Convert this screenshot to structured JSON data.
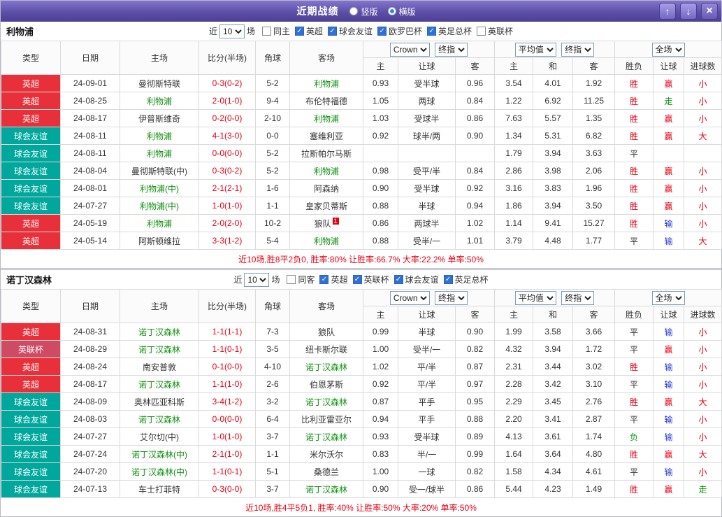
{
  "titlebar": {
    "title": "近期战绩",
    "view_options": [
      {
        "label": "竖版",
        "selected": false
      },
      {
        "label": "横版",
        "selected": true
      }
    ],
    "buttons": {
      "up": "↑",
      "down": "↓",
      "close": "×"
    }
  },
  "colors": {
    "league": {
      "英超": "#e8303a",
      "球会友谊": "#00a79d",
      "英联杯": "#cf4a63",
      "欧罗巴杯": "#cf7a2a",
      "英足总杯": "#3a6fd0"
    },
    "result": {
      "胜": "#e60012",
      "平": "#333333",
      "负": "#0a9a0a"
    },
    "handicap": {
      "赢": "#e60012",
      "走": "#0a9a0a",
      "输": "#2433cc"
    },
    "goals": {
      "大": "#e60012",
      "小": "#e60012",
      "走": "#0a9a0a"
    },
    "team_highlight": "#0a8f0a",
    "score": "#e60012",
    "checkbox_checked": "#2f71d8"
  },
  "table_header": {
    "type": "类型",
    "date": "日期",
    "home": "主场",
    "score": "比分(半场)",
    "corner": "角球",
    "away": "客场",
    "odds1": {
      "select1": "Crown",
      "select2": "终指",
      "cols": [
        "主",
        "让球",
        "客"
      ]
    },
    "odds2": {
      "select1": "平均值",
      "select2": "终指",
      "cols": [
        "主",
        "和",
        "客"
      ]
    },
    "result_group": {
      "select": "全场",
      "cols": [
        "胜负",
        "让球",
        "进球数"
      ]
    }
  },
  "sections": [
    {
      "team": "利物浦",
      "filter": {
        "prefix": "近",
        "count": "10",
        "suffix": "场",
        "checkboxes": [
          {
            "label": "同主",
            "checked": false
          },
          {
            "label": "英超",
            "checked": true
          },
          {
            "label": "球会友谊",
            "checked": true
          },
          {
            "label": "欧罗巴杯",
            "checked": true
          },
          {
            "label": "英足总杯",
            "checked": true
          },
          {
            "label": "英联杯",
            "checked": false
          }
        ]
      },
      "rows": [
        {
          "league": "英超",
          "date": "24-09-01",
          "home": "曼彻斯特联",
          "score": "0-3(0-2)",
          "corner": "5-2",
          "away": "利物浦",
          "o1": [
            "0.93",
            "受半球",
            "0.96"
          ],
          "o2": [
            "3.54",
            "4.01",
            "1.92"
          ],
          "res": "胜",
          "bet": "赢",
          "goal": "小"
        },
        {
          "league": "英超",
          "date": "24-08-25",
          "home": "利物浦",
          "score": "2-0(1-0)",
          "corner": "9-4",
          "away": "布伦特福德",
          "o1": [
            "1.05",
            "两球",
            "0.84"
          ],
          "o2": [
            "1.22",
            "6.92",
            "11.25"
          ],
          "res": "胜",
          "bet": "走",
          "goal": "小"
        },
        {
          "league": "英超",
          "date": "24-08-17",
          "home": "伊普斯维奇",
          "score": "0-2(0-0)",
          "corner": "2-10",
          "away": "利物浦",
          "o1": [
            "1.03",
            "受球半",
            "0.86"
          ],
          "o2": [
            "7.63",
            "5.57",
            "1.35"
          ],
          "res": "胜",
          "bet": "赢",
          "goal": "小"
        },
        {
          "league": "球会友谊",
          "date": "24-08-11",
          "home": "利物浦",
          "score": "4-1(3-0)",
          "corner": "0-0",
          "away": "塞维利亚",
          "o1": [
            "0.92",
            "球半/两",
            "0.90"
          ],
          "o2": [
            "1.34",
            "5.31",
            "6.82"
          ],
          "res": "胜",
          "bet": "赢",
          "goal": "大"
        },
        {
          "league": "球会友谊",
          "date": "24-08-11",
          "home": "利物浦",
          "score": "0-0(0-0)",
          "corner": "5-2",
          "away": "拉斯帕尔马斯",
          "o1": [
            "",
            "",
            ""
          ],
          "o2": [
            "1.79",
            "3.94",
            "3.63"
          ],
          "res": "平",
          "bet": "",
          "goal": ""
        },
        {
          "league": "球会友谊",
          "date": "24-08-04",
          "home": "曼彻斯特联(中)",
          "score": "0-3(0-2)",
          "corner": "5-2",
          "away": "利物浦",
          "o1": [
            "0.98",
            "受平/半",
            "0.84"
          ],
          "o2": [
            "2.86",
            "3.98",
            "2.06"
          ],
          "res": "胜",
          "bet": "赢",
          "goal": "小"
        },
        {
          "league": "球会友谊",
          "date": "24-08-01",
          "home": "利物浦(中)",
          "score": "2-1(2-1)",
          "corner": "1-6",
          "away": "阿森纳",
          "o1": [
            "0.90",
            "受半球",
            "0.92"
          ],
          "o2": [
            "3.16",
            "3.83",
            "1.96"
          ],
          "res": "胜",
          "bet": "赢",
          "goal": "小"
        },
        {
          "league": "球会友谊",
          "date": "24-07-27",
          "home": "利物浦(中)",
          "score": "1-0(1-0)",
          "corner": "1-1",
          "away": "皇家贝蒂斯",
          "o1": [
            "0.88",
            "半球",
            "0.94"
          ],
          "o2": [
            "1.86",
            "3.94",
            "3.50"
          ],
          "res": "胜",
          "bet": "赢",
          "goal": "小"
        },
        {
          "league": "英超",
          "date": "24-05-19",
          "home": "利物浦",
          "score": "2-0(2-0)",
          "corner": "10-2",
          "away": "狼队",
          "away_sup": "1",
          "o1": [
            "0.86",
            "两球半",
            "1.02"
          ],
          "o2": [
            "1.14",
            "9.41",
            "15.27"
          ],
          "res": "胜",
          "bet": "输",
          "goal": "小"
        },
        {
          "league": "英超",
          "date": "24-05-14",
          "home": "阿斯顿维拉",
          "score": "3-3(1-2)",
          "corner": "5-4",
          "away": "利物浦",
          "o1": [
            "0.88",
            "受半/一",
            "1.01"
          ],
          "o2": [
            "3.79",
            "4.48",
            "1.77"
          ],
          "res": "平",
          "bet": "输",
          "goal": "大"
        }
      ],
      "summary": "近10场,胜8平2负0, 胜率:80% 让胜率:66.7% 大率:22.2% 单率:50%"
    },
    {
      "team": "诺丁汉森林",
      "filter": {
        "prefix": "近",
        "count": "10",
        "suffix": "场",
        "checkboxes": [
          {
            "label": "同客",
            "checked": false
          },
          {
            "label": "英超",
            "checked": true
          },
          {
            "label": "英联杯",
            "checked": true
          },
          {
            "label": "球会友谊",
            "checked": true
          },
          {
            "label": "英足总杯",
            "checked": true
          }
        ]
      },
      "rows": [
        {
          "league": "英超",
          "date": "24-08-31",
          "home": "诺丁汉森林",
          "score": "1-1(1-1)",
          "corner": "7-3",
          "away": "狼队",
          "o1": [
            "0.99",
            "半球",
            "0.90"
          ],
          "o2": [
            "1.99",
            "3.58",
            "3.66"
          ],
          "res": "平",
          "bet": "输",
          "goal": "小"
        },
        {
          "league": "英联杯",
          "date": "24-08-29",
          "home": "诺丁汉森林",
          "score": "1-1(0-1)",
          "corner": "3-5",
          "away": "纽卡斯尔联",
          "o1": [
            "1.00",
            "受半/一",
            "0.82"
          ],
          "o2": [
            "4.32",
            "3.94",
            "1.72"
          ],
          "res": "平",
          "bet": "赢",
          "goal": "小"
        },
        {
          "league": "英超",
          "date": "24-08-24",
          "home": "南安普敦",
          "score": "0-1(0-0)",
          "corner": "4-10",
          "away": "诺丁汉森林",
          "o1": [
            "1.02",
            "平/半",
            "0.87"
          ],
          "o2": [
            "2.31",
            "3.44",
            "3.02"
          ],
          "res": "胜",
          "bet": "输",
          "goal": "小"
        },
        {
          "league": "英超",
          "date": "24-08-17",
          "home": "诺丁汉森林",
          "score": "1-1(1-0)",
          "corner": "2-6",
          "away": "伯恩茅斯",
          "o1": [
            "0.92",
            "平/半",
            "0.97"
          ],
          "o2": [
            "2.28",
            "3.42",
            "3.10"
          ],
          "res": "平",
          "bet": "输",
          "goal": "小"
        },
        {
          "league": "球会友谊",
          "date": "24-08-09",
          "home": "奥林匹亚科斯",
          "score": "3-4(1-2)",
          "corner": "3-2",
          "away": "诺丁汉森林",
          "o1": [
            "0.87",
            "平手",
            "0.95"
          ],
          "o2": [
            "2.29",
            "3.45",
            "2.76"
          ],
          "res": "胜",
          "bet": "赢",
          "goal": "大"
        },
        {
          "league": "球会友谊",
          "date": "24-08-03",
          "home": "诺丁汉森林",
          "score": "0-0(0-0)",
          "corner": "6-4",
          "away": "比利亚雷亚尔",
          "o1": [
            "0.94",
            "平手",
            "0.88"
          ],
          "o2": [
            "2.20",
            "3.41",
            "2.87"
          ],
          "res": "平",
          "bet": "输",
          "goal": "小"
        },
        {
          "league": "球会友谊",
          "date": "24-07-27",
          "home": "艾尔切(中)",
          "score": "1-0(1-0)",
          "corner": "3-7",
          "away": "诺丁汉森林",
          "o1": [
            "0.93",
            "受半球",
            "0.89"
          ],
          "o2": [
            "4.13",
            "3.61",
            "1.74"
          ],
          "res": "负",
          "bet": "输",
          "goal": "小"
        },
        {
          "league": "球会友谊",
          "date": "24-07-24",
          "home": "诺丁汉森林(中)",
          "score": "2-1(1-0)",
          "corner": "1-1",
          "away": "米尔沃尔",
          "o1": [
            "0.83",
            "半/一",
            "0.99"
          ],
          "o2": [
            "1.64",
            "3.64",
            "4.80"
          ],
          "res": "胜",
          "bet": "赢",
          "goal": "大"
        },
        {
          "league": "球会友谊",
          "date": "24-07-20",
          "home": "诺丁汉森林(中)",
          "score": "1-1(0-1)",
          "corner": "5-1",
          "away": "桑德兰",
          "o1": [
            "1.00",
            "一球",
            "0.82"
          ],
          "o2": [
            "1.58",
            "4.34",
            "4.61"
          ],
          "res": "平",
          "bet": "输",
          "goal": "小"
        },
        {
          "league": "球会友谊",
          "date": "24-07-13",
          "home": "车士打菲特",
          "score": "0-3(0-0)",
          "corner": "3-7",
          "away": "诺丁汉森林",
          "o1": [
            "0.90",
            "受一/球半",
            "0.86"
          ],
          "o2": [
            "5.44",
            "4.23",
            "1.49"
          ],
          "res": "胜",
          "bet": "赢",
          "goal": "走"
        }
      ],
      "summary": "近10场,胜4平5负1, 胜率:40% 让胜率:50% 大率:20% 单率:50%"
    }
  ]
}
